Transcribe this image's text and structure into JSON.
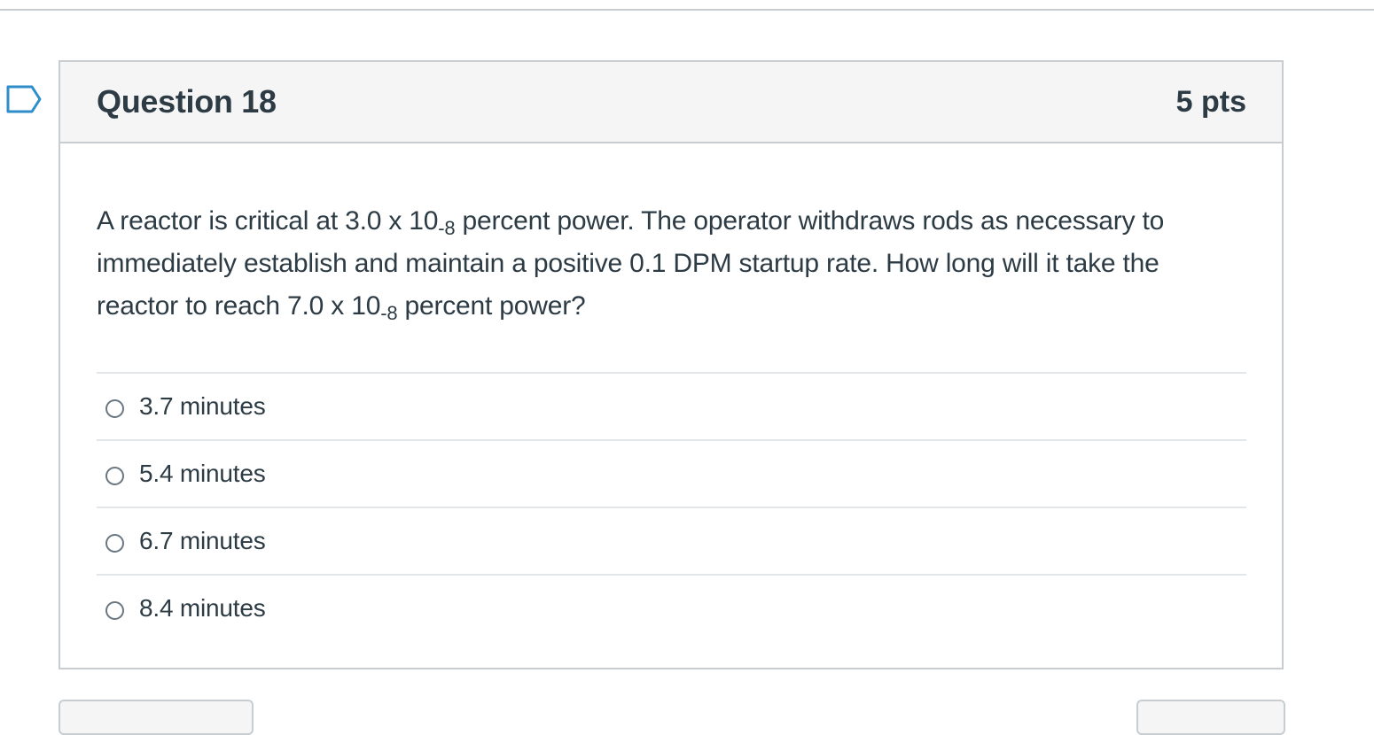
{
  "question": {
    "title": "Question 18",
    "points": "5 pts",
    "text_parts": {
      "p1": "A reactor is critical at 3.0 x 10",
      "exp1": "-8",
      "p2": " percent power. The operator withdraws rods as necessary to immediately establish and maintain a positive 0.1 DPM startup rate. How long will it take the reactor to reach 7.0 x 10",
      "exp2": "-8",
      "p3": " percent power?"
    },
    "answers": [
      {
        "label": "3.7 minutes",
        "selected": false
      },
      {
        "label": "5.4 minutes",
        "selected": false
      },
      {
        "label": "6.7 minutes",
        "selected": false
      },
      {
        "label": "8.4 minutes",
        "selected": false
      }
    ]
  },
  "colors": {
    "text": "#2d3b45",
    "border": "#c7cdd1",
    "header_bg": "#f5f5f5",
    "flag": "#2d8ec9"
  },
  "icons": {
    "flag": "flag-question-icon",
    "radio": "radio-button-icon"
  }
}
